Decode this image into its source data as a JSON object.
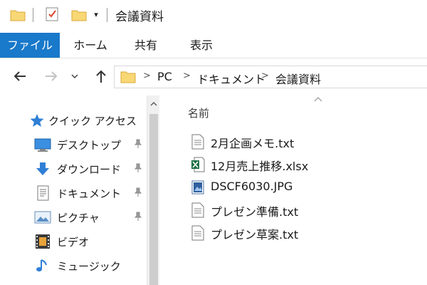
{
  "window": {
    "title": "会議資料"
  },
  "quick_access_toolbar": {
    "dropdown_glyph": "▾"
  },
  "ribbon": {
    "tabs": [
      {
        "label": "ファイル",
        "active": true
      },
      {
        "label": "ホーム"
      },
      {
        "label": "共有"
      },
      {
        "label": "表示"
      }
    ]
  },
  "address": {
    "breadcrumbs": [
      "PC",
      "ドキュメント",
      "会議資料"
    ]
  },
  "nav_pane": {
    "items": [
      {
        "label": "クイック アクセス",
        "icon": "star-icon",
        "pinned": false
      },
      {
        "label": "デスクトップ",
        "icon": "desktop-icon",
        "pinned": true
      },
      {
        "label": "ダウンロード",
        "icon": "download-icon",
        "pinned": true
      },
      {
        "label": "ドキュメント",
        "icon": "documents-icon",
        "pinned": true
      },
      {
        "label": "ピクチャ",
        "icon": "pictures-icon",
        "pinned": true
      },
      {
        "label": "ビデオ",
        "icon": "video-icon",
        "pinned": false
      },
      {
        "label": "ミュージック",
        "icon": "music-icon",
        "pinned": false
      }
    ]
  },
  "content": {
    "column_header": "名前",
    "files": [
      {
        "name": "2月企画メモ.txt",
        "icon": "text-file-icon"
      },
      {
        "name": "12月売上推移.xlsx",
        "icon": "excel-file-icon"
      },
      {
        "name": "DSCF6030.JPG",
        "icon": "image-file-icon"
      },
      {
        "name": "プレゼン準備.txt",
        "icon": "text-file-icon"
      },
      {
        "name": "プレゼン草案.txt",
        "icon": "text-file-icon"
      }
    ]
  },
  "colors": {
    "accent": "#1979ca",
    "folder": "#f8d775"
  }
}
